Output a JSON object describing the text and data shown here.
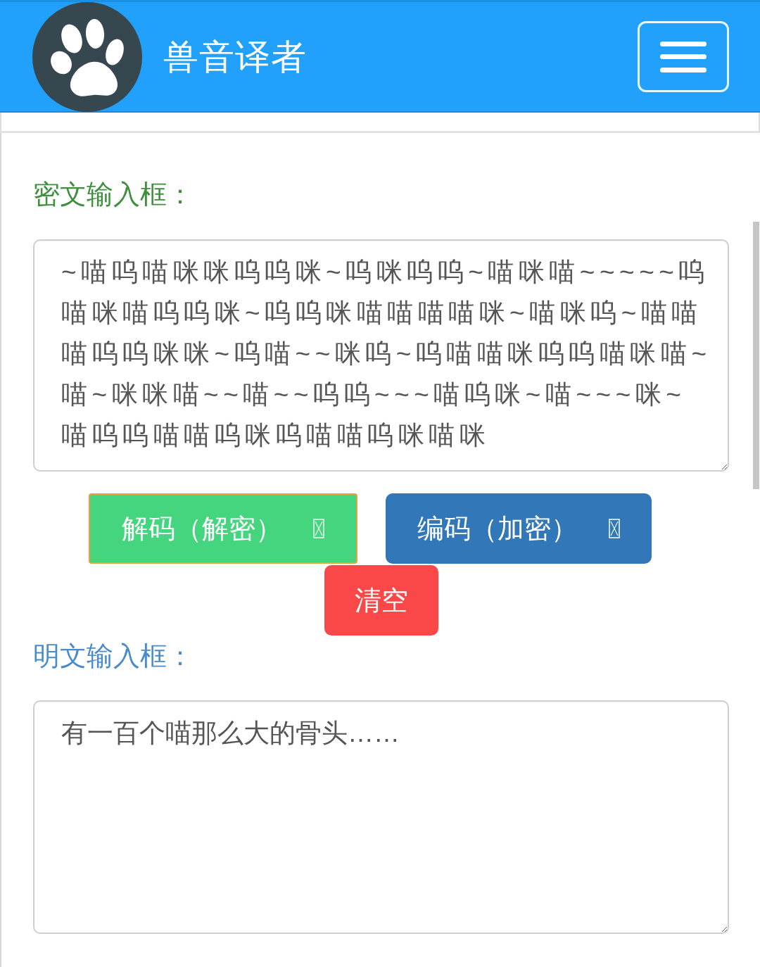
{
  "header": {
    "title": "兽音译者"
  },
  "cipher": {
    "label": "密文输入框：",
    "value": "~喵呜喵咪咪呜呜咪~呜咪呜呜~喵咪喵~~~~~呜喵咪喵呜呜咪~呜呜咪喵喵喵喵咪~喵咪呜~喵喵喵呜呜咪咪~呜喵~~咪呜~呜喵喵咪呜呜喵咪喵~喵~咪咪喵~~喵~~呜呜~~~喵呜咪~喵~~~咪~喵呜呜喵喵呜咪呜喵喵呜咪喵咪"
  },
  "actions": [
    {
      "kind": "decode",
      "label": "解码（解密）",
      "focused": true
    },
    {
      "kind": "encode",
      "label": "编码（加密）",
      "focused": false
    },
    {
      "kind": "clear",
      "label": "清空",
      "focused": false
    }
  ],
  "plain": {
    "label": "明文输入框：",
    "value": "有一百个喵那么大的骨头……"
  }
}
